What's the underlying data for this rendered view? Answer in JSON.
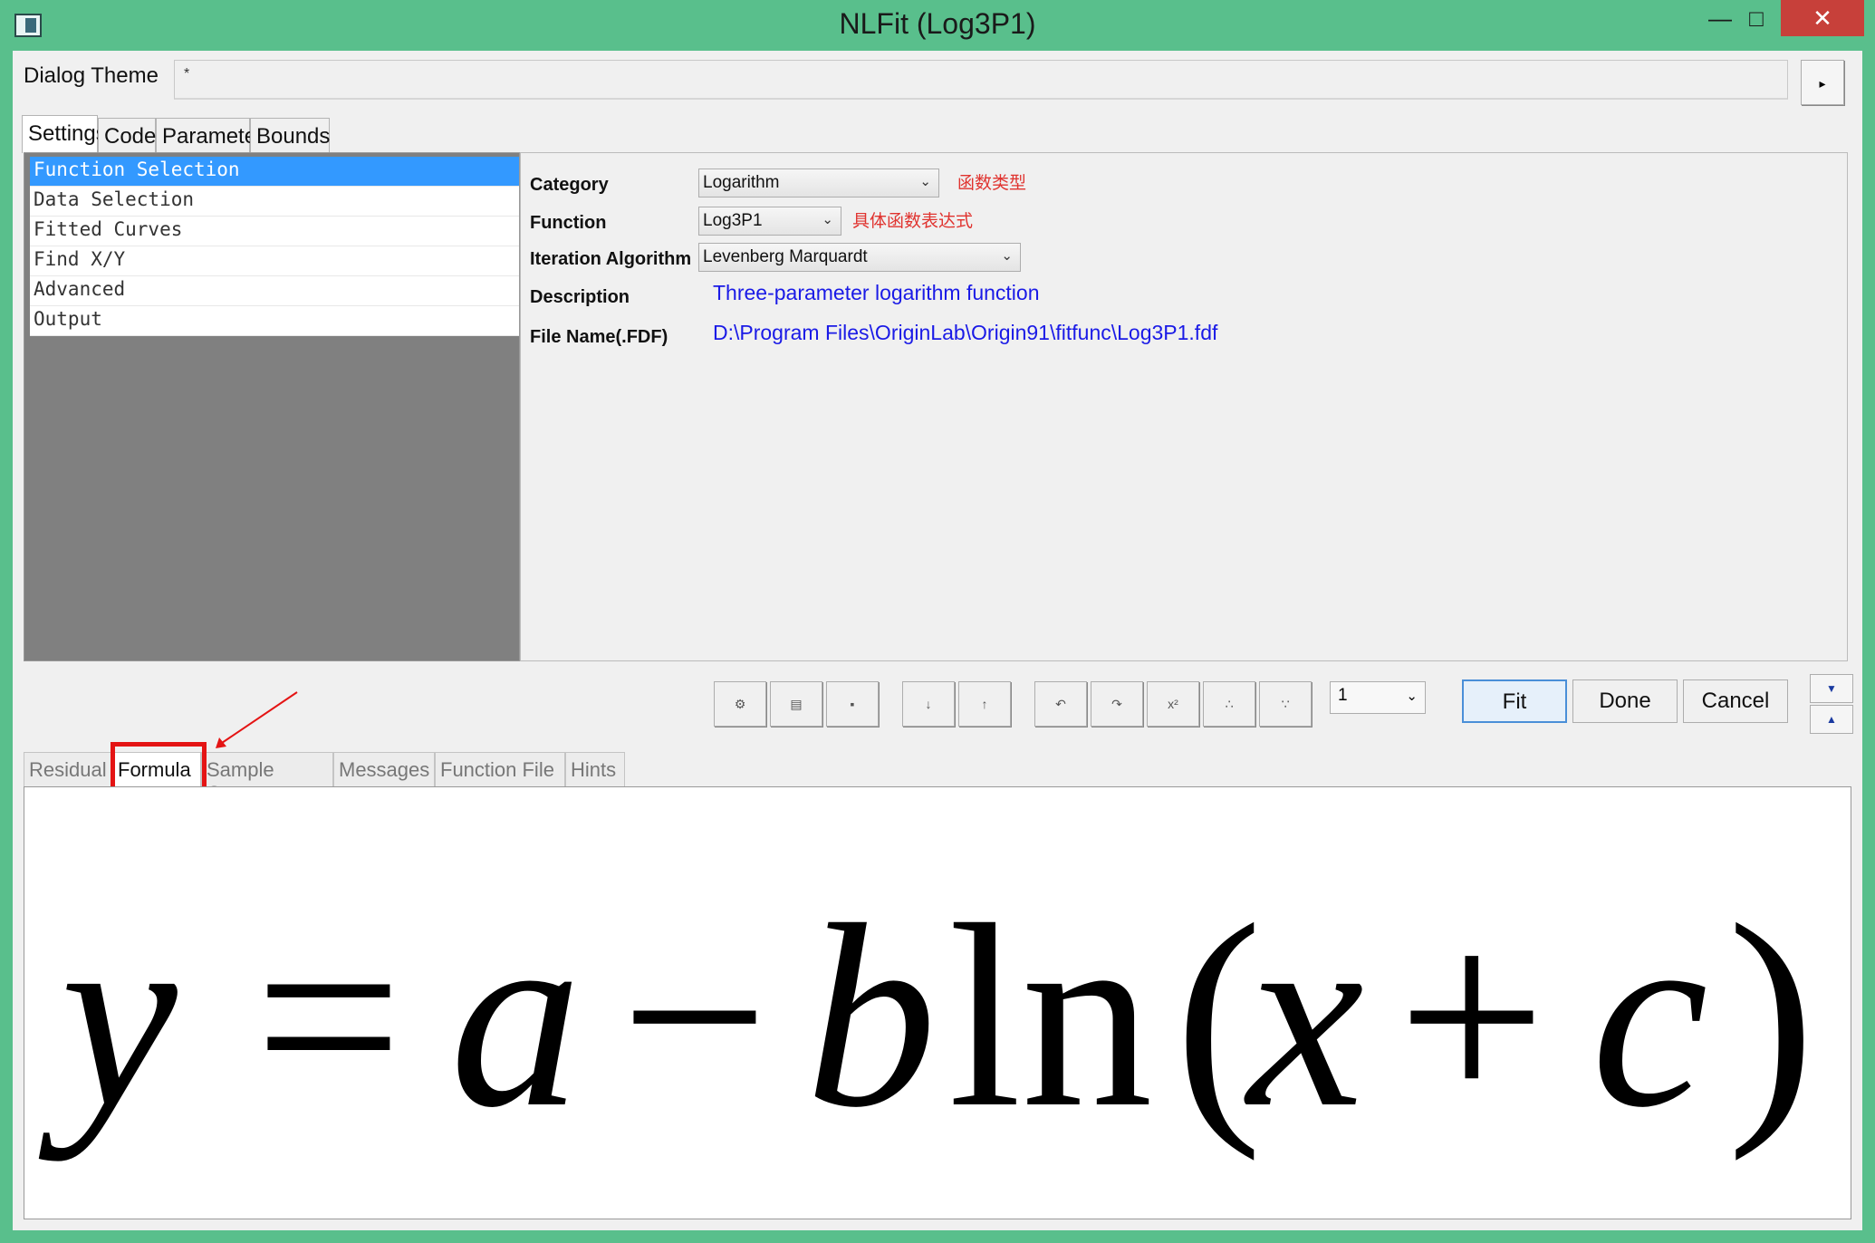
{
  "window": {
    "title": "NLFit (Log3P1)",
    "minimize_glyph": "—",
    "maximize_glyph": "□",
    "close_glyph": "✕"
  },
  "theme": {
    "label": "Dialog Theme",
    "value": "*",
    "menu_arrow": "▸"
  },
  "top_tabs": [
    "Settings",
    "Code",
    "Parameters",
    "Bounds"
  ],
  "tree": {
    "items": [
      "Function Selection",
      "Data Selection",
      "Fitted Curves",
      "Find X/Y",
      "Advanced",
      "Output"
    ],
    "selected": "Function Selection"
  },
  "settings": {
    "category_label": "Category",
    "category_value": "Logarithm",
    "category_note": "函数类型",
    "function_label": "Function",
    "function_value": "Log3P1",
    "function_note": "具体函数表达式",
    "iteration_label": "Iteration Algorithm",
    "iteration_value": "Levenberg Marquardt",
    "description_label": "Description",
    "description_value": "Three-parameter logarithm function",
    "filename_label": "File Name(.FDF)",
    "filename_value": "D:\\Program Files\\OriginLab\\Origin91\\fitfunc\\Log3P1.fdf"
  },
  "toolbar": {
    "icons": [
      "fit-new-icon",
      "copy-icon",
      "save-icon",
      "sort-down-icon",
      "sort-up-icon",
      "undo-icon",
      "redo-icon",
      "x-squared-icon",
      "param-a-icon",
      "param-b-icon"
    ],
    "page_value": "1",
    "fit_label": "Fit",
    "done_label": "Done",
    "cancel_label": "Cancel"
  },
  "bottom_tabs": [
    "Residual",
    "Formula",
    "Sample Curve",
    "Messages",
    "Function File",
    "Hints"
  ],
  "bottom_active": "Formula",
  "formula": {
    "y": "y",
    "eq": "=",
    "a": "a",
    "minus": "−",
    "b": "b",
    "ln": "ln",
    "lparen": "(",
    "x": "x",
    "plus": "+",
    "c": "c",
    "rparen": ")"
  },
  "colors": {
    "window_frame": "#59bf8c",
    "close_button": "#c7403a",
    "selection": "#3399ff",
    "note_red": "#e0332f",
    "value_blue": "#1a1ae6",
    "highlight_red": "#e41414"
  }
}
